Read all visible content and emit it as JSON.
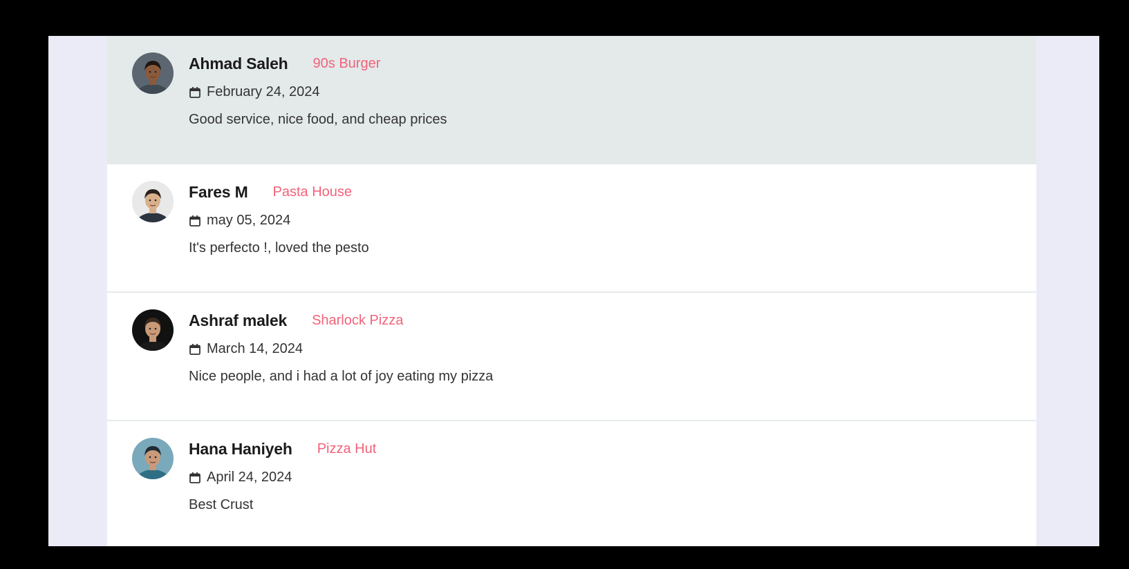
{
  "reviews": [
    {
      "name": "Ahmad Saleh",
      "restaurant": "90s Burger",
      "date": "February 24, 2024",
      "text": "Good service, nice food, and cheap prices",
      "avatar": {
        "skin": "#8a5a3b",
        "hair": "#1d1612",
        "shirt": "#3f4a55",
        "bg": "#5b6670"
      }
    },
    {
      "name": "Fares M",
      "restaurant": "Pasta House",
      "date": "may 05, 2024",
      "text": "It's perfecto !, loved the pesto",
      "avatar": {
        "skin": "#d9b08c",
        "hair": "#2a211c",
        "shirt": "#2c3440",
        "bg": "#e9e9e9"
      }
    },
    {
      "name": "Ashraf malek",
      "restaurant": "Sharlock Pizza",
      "date": "March 14, 2024",
      "text": "Nice people, and i had a lot of joy eating my pizza",
      "avatar": {
        "skin": "#c99a78",
        "hair": "#3a2a20",
        "shirt": "#1a1a1a",
        "bg": "#111111"
      }
    },
    {
      "name": "Hana Haniyeh",
      "restaurant": "Pizza Hut",
      "date": "April 24, 2024",
      "text": "Best Crust",
      "avatar": {
        "skin": "#c89a7a",
        "hair": "#1e2b33",
        "shirt": "#2f6f86",
        "bg": "#7aa9bb"
      }
    }
  ]
}
